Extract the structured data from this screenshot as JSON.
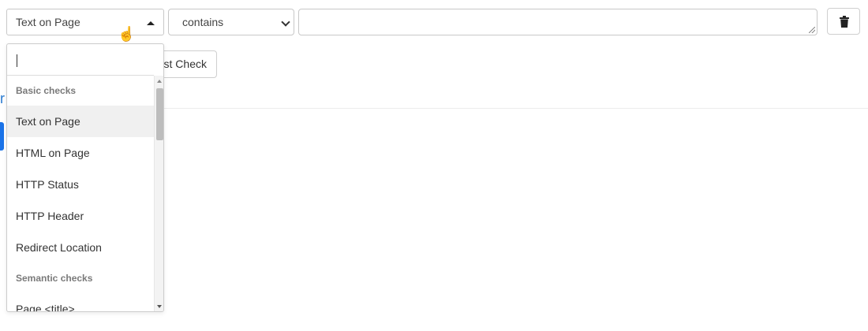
{
  "check_row": {
    "check_type_value": "Text on Page",
    "operator_value": "contains",
    "value_text": "",
    "delete_icon": "trash-icon"
  },
  "test_check_button_label": "st Check",
  "left_fragment_text": "r",
  "dropdown": {
    "search_value": "",
    "groups": [
      {
        "label": "Basic checks",
        "options": [
          "Text on Page",
          "HTML on Page",
          "HTTP Status",
          "HTTP Header",
          "Redirect Location"
        ]
      },
      {
        "label": "Semantic checks",
        "options": [
          "Page <title>"
        ]
      }
    ],
    "highlighted_option": "Text on Page"
  },
  "colors": {
    "accent": "#1a73e8",
    "link": "#2a7bd1",
    "highlight": "#f0f0f0"
  }
}
